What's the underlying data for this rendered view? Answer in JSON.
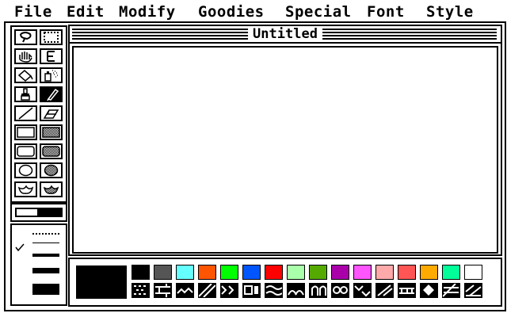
{
  "menubar": {
    "items": [
      {
        "label": "File"
      },
      {
        "label": "Edit"
      },
      {
        "label": "Modify"
      },
      {
        "label": "Goodies"
      },
      {
        "label": "Special"
      },
      {
        "label": "Font"
      },
      {
        "label": "Style"
      }
    ]
  },
  "window": {
    "title": "Untitled"
  },
  "tools": {
    "items": [
      {
        "name": "lasso-tool-icon"
      },
      {
        "name": "marquee-select-tool-icon"
      },
      {
        "name": "grabber-hand-tool-icon"
      },
      {
        "name": "text-tool-icon"
      },
      {
        "name": "paint-bucket-tool-icon"
      },
      {
        "name": "spray-can-tool-icon"
      },
      {
        "name": "paintbrush-tool-icon"
      },
      {
        "name": "pencil-tool-icon",
        "selected": true
      },
      {
        "name": "line-tool-icon"
      },
      {
        "name": "eraser-tool-icon"
      },
      {
        "name": "rectangle-tool-icon"
      },
      {
        "name": "filled-rectangle-tool-icon"
      },
      {
        "name": "rounded-rectangle-tool-icon"
      },
      {
        "name": "filled-rounded-rectangle-tool-icon"
      },
      {
        "name": "oval-tool-icon"
      },
      {
        "name": "filled-oval-tool-icon"
      },
      {
        "name": "freeform-shape-tool-icon"
      },
      {
        "name": "filled-freeform-tool-icon"
      }
    ]
  },
  "line_widths": {
    "selected_index": 1,
    "options": [
      "dotted",
      "thin",
      "medium",
      "thick",
      "extra-thick"
    ]
  },
  "palette": {
    "current_color": "#000000",
    "colors": [
      "#000000",
      "#555555",
      "#66ffff",
      "#ff5500",
      "#00ff00",
      "#0055ff",
      "#ff0000",
      "#aaffaa",
      "#55aa00",
      "#aa00aa",
      "#ff55ff",
      "#ffaaaa",
      "#ff5555",
      "#ffaa00",
      "#00ff99",
      "#ffffff"
    ],
    "patterns": [
      "checker-pattern",
      "brick-pattern",
      "zigzag-pattern",
      "diagonal-pattern",
      "weave-pattern",
      "box-pattern",
      "wave-pattern",
      "scale-pattern",
      "arch-pattern",
      "circle-pattern",
      "herringbone-pattern",
      "slash-pattern",
      "shingle-pattern",
      "diamond-pattern",
      "hatch-pattern",
      "diag-hatch-pattern"
    ]
  }
}
